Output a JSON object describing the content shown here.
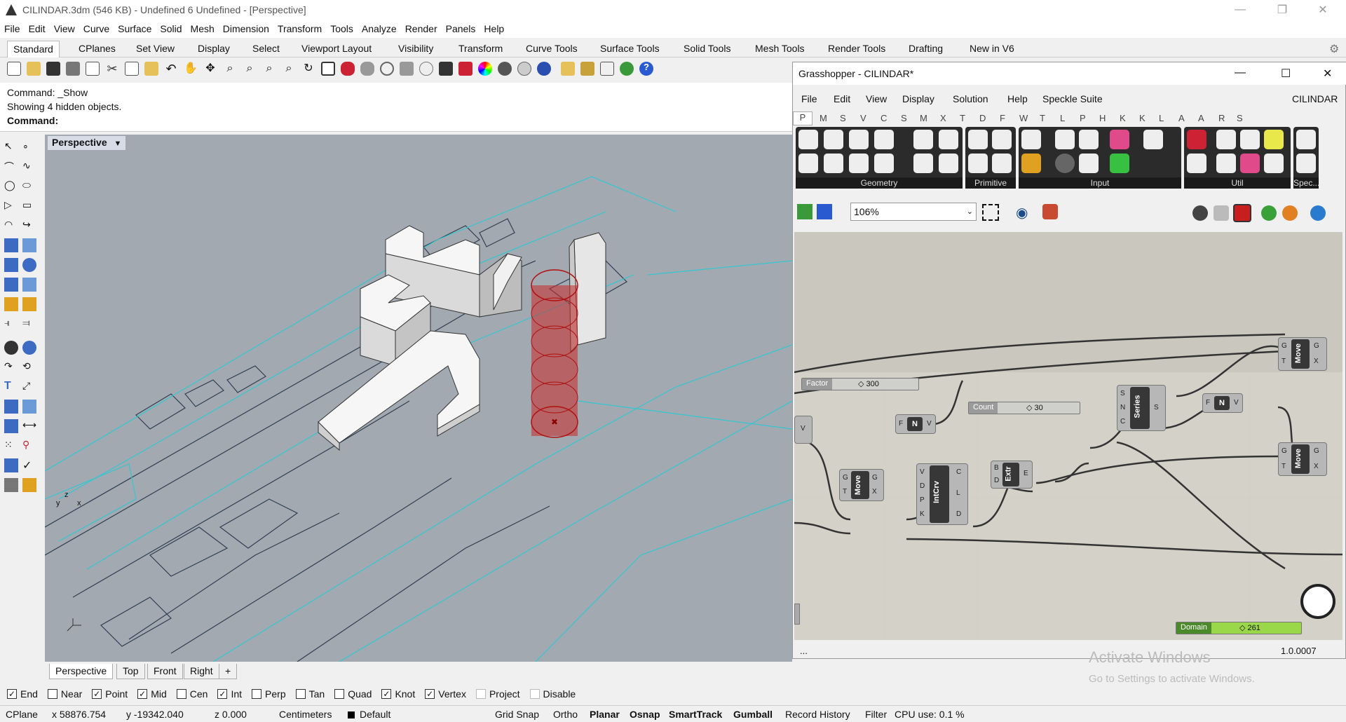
{
  "window": {
    "title": "CILINDAR.3dm (546 KB) - Undefined 6 Undefined - [Perspective]"
  },
  "menu": [
    "File",
    "Edit",
    "View",
    "Curve",
    "Surface",
    "Solid",
    "Mesh",
    "Dimension",
    "Transform",
    "Tools",
    "Analyze",
    "Render",
    "Panels",
    "Help"
  ],
  "tabs": [
    "Standard",
    "CPlanes",
    "Set View",
    "Display",
    "Select",
    "Viewport Layout",
    "Visibility",
    "Transform",
    "Curve Tools",
    "Surface Tools",
    "Solid Tools",
    "Mesh Tools",
    "Render Tools",
    "Drafting",
    "New in V6"
  ],
  "command": {
    "line1": "Command: _Show",
    "line2": "Showing 4 hidden objects.",
    "prompt": "Command:"
  },
  "viewport": {
    "label": "Perspective",
    "axes": {
      "x": "x",
      "y": "y",
      "z": "z"
    }
  },
  "viewport_tabs": [
    "Perspective",
    "Top",
    "Front",
    "Right",
    "+"
  ],
  "osnap": [
    {
      "label": "End",
      "checked": true
    },
    {
      "label": "Near",
      "checked": false
    },
    {
      "label": "Point",
      "checked": true
    },
    {
      "label": "Mid",
      "checked": true
    },
    {
      "label": "Cen",
      "checked": false
    },
    {
      "label": "Int",
      "checked": true
    },
    {
      "label": "Perp",
      "checked": false
    },
    {
      "label": "Tan",
      "checked": false
    },
    {
      "label": "Quad",
      "checked": false
    },
    {
      "label": "Knot",
      "checked": true
    },
    {
      "label": "Vertex",
      "checked": true
    },
    {
      "label": "Project",
      "checked": false
    },
    {
      "label": "Disable",
      "checked": false
    }
  ],
  "status": {
    "cplane": "CPlane",
    "x": "x 58876.754",
    "y": "y -19342.040",
    "z": "z 0.000",
    "units": "Centimeters",
    "layer": "Default",
    "grid_snap": "Grid Snap",
    "ortho": "Ortho",
    "planar": "Planar",
    "osnap": "Osnap",
    "smarttrack": "SmartTrack",
    "gumball": "Gumball",
    "record_history": "Record History",
    "filter": "Filter",
    "cpu": "CPU use: 0.1 %"
  },
  "grasshopper": {
    "title": "Grasshopper - CILINDAR*",
    "menu": [
      "File",
      "Edit",
      "View",
      "Display",
      "Solution",
      "Help",
      "Speckle Suite"
    ],
    "doc_name": "CILINDAR",
    "categories": [
      "P",
      "M",
      "S",
      "V",
      "C",
      "S",
      "M",
      "X",
      "T",
      "D",
      "F",
      "W",
      "T",
      "L",
      "P",
      "H",
      "K",
      "K",
      "L",
      "A",
      "A",
      "R",
      "S"
    ],
    "groups": [
      "Geometry",
      "Primitive",
      "Input",
      "Util",
      "Spec..."
    ],
    "zoom": "106%",
    "sliders": [
      {
        "name": "Factor",
        "value": "◇ 300"
      },
      {
        "name": "Count",
        "value": "◇ 30"
      },
      {
        "name": "Domain",
        "value": "◇ 261"
      }
    ],
    "components": {
      "move1": "Move",
      "move2": "Move",
      "move3": "Move",
      "series": "Series",
      "neg1": "N",
      "neg2": "N",
      "extr": "Extr",
      "intcrv": "IntCrv"
    },
    "footer_left": "...",
    "footer_right": "1.0.0007"
  },
  "watermark": {
    "line1": "Activate Windows",
    "line2": "Go to Settings to activate Windows."
  },
  "colors": {
    "accent_red": "#c81e1e",
    "viewport_bg": "#a3a9b0",
    "gh_canvas": "#d4d2c8"
  }
}
